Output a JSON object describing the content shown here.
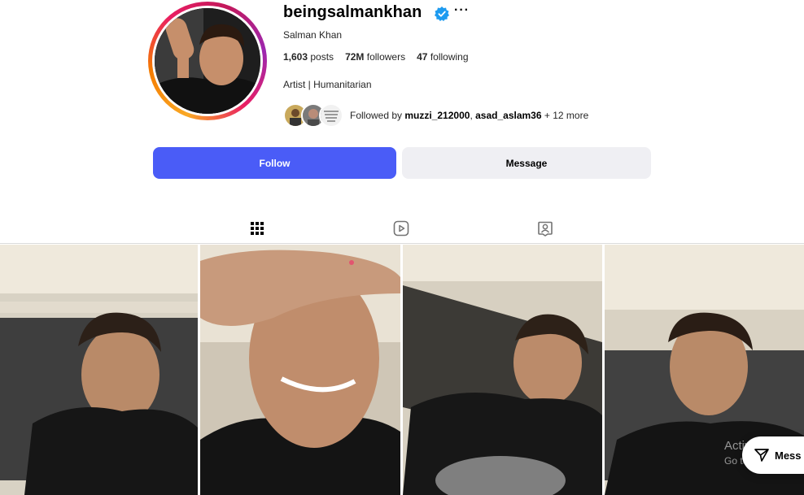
{
  "profile": {
    "username": "beingsalmankhan",
    "verified_icon": "verified-badge-icon",
    "more_label": "···",
    "full_name": "Salman Khan",
    "bio": "Artist | Humanitarian",
    "stats": {
      "posts_count": "1,603",
      "posts_label": "posts",
      "followers_count": "72M",
      "followers_label": "followers",
      "following_count": "47",
      "following_label": "following"
    },
    "followed_by": {
      "prefix": "Followed by",
      "user1": "muzzi_212000",
      "separator": ",",
      "user2": "asad_aslam36",
      "suffix": "+ 12 more"
    }
  },
  "actions": {
    "follow_label": "Follow",
    "message_label": "Message"
  },
  "tabs": [
    {
      "name": "posts",
      "icon": "grid-icon",
      "active": true
    },
    {
      "name": "reels",
      "icon": "reels-icon",
      "active": false
    },
    {
      "name": "tagged",
      "icon": "tagged-user-icon",
      "active": false
    }
  ],
  "overlay": {
    "watermark_line1": "Activate W",
    "watermark_line2": "Go to Settings",
    "message_fab_label": "Mess"
  },
  "colors": {
    "follow_button": "#4a5cf7",
    "message_button": "#efeff3",
    "verified": "#1d9bf0"
  }
}
